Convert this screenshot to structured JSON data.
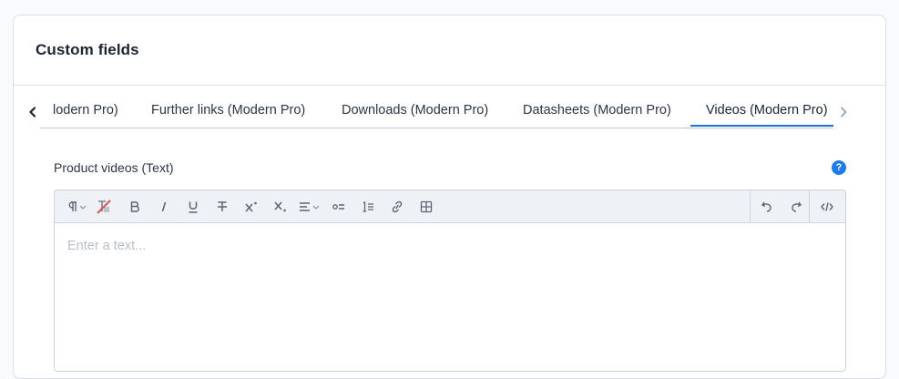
{
  "card": {
    "title": "Custom fields"
  },
  "tabs": {
    "items": [
      {
        "label": "lodern Pro)"
      },
      {
        "label": "Further links (Modern Pro)"
      },
      {
        "label": "Downloads (Modern Pro)"
      },
      {
        "label": "Datasheets (Modern Pro)"
      },
      {
        "label": "Videos (Modern Pro)",
        "active": true
      }
    ],
    "prev_icon": "chevron-left-icon",
    "next_icon": "chevron-right-icon"
  },
  "field": {
    "label": "Product videos (Text)",
    "help_icon_text": "?"
  },
  "editor": {
    "placeholder": "Enter a text...",
    "toolbar": [
      "paragraph-format-icon",
      "clear-format-icon",
      "bold-icon",
      "italic-icon",
      "underline-icon",
      "strikethrough-icon",
      "superscript-icon",
      "subscript-icon",
      "align-icon",
      "bullet-list-icon",
      "numbered-list-icon",
      "link-icon",
      "table-icon",
      "undo-icon",
      "redo-icon",
      "code-view-icon"
    ]
  },
  "colors": {
    "accent": "#1976d2",
    "help": "#1f7aea"
  }
}
